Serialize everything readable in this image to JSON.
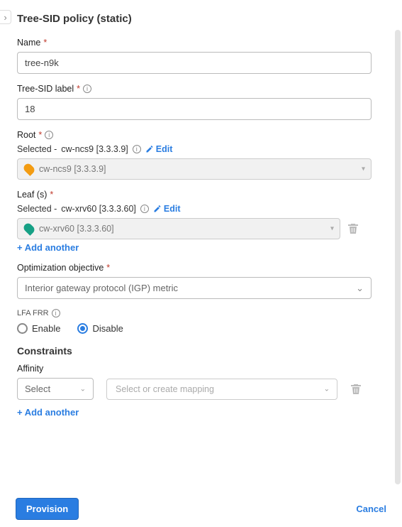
{
  "title": "Tree-SID policy (static)",
  "name_field": {
    "label": "Name",
    "value": "tree-n9k"
  },
  "label_field": {
    "label": "Tree-SID label",
    "value": "18"
  },
  "root": {
    "label": "Root",
    "selected_prefix": "Selected - ",
    "selected_value": "cw-ncs9 [3.3.3.9]",
    "dropdown_text": "cw-ncs9 [3.3.3.9]",
    "edit": "Edit"
  },
  "leaf": {
    "label": "Leaf (s)",
    "selected_prefix": "Selected - ",
    "selected_value": "cw-xrv60 [3.3.3.60]",
    "dropdown_text": "cw-xrv60 [3.3.3.60]",
    "edit": "Edit",
    "add_another": "+ Add another"
  },
  "optimization": {
    "label": "Optimization objective",
    "value": "Interior gateway protocol (IGP) metric"
  },
  "lfa": {
    "label": "LFA FRR",
    "enable": "Enable",
    "disable": "Disable",
    "selected": "disable"
  },
  "constraints": {
    "heading": "Constraints",
    "affinity_label": "Affinity",
    "affinity_select": "Select",
    "mapping_placeholder": "Select or create mapping",
    "add_another": "+ Add another"
  },
  "footer": {
    "provision": "Provision",
    "cancel": "Cancel"
  }
}
